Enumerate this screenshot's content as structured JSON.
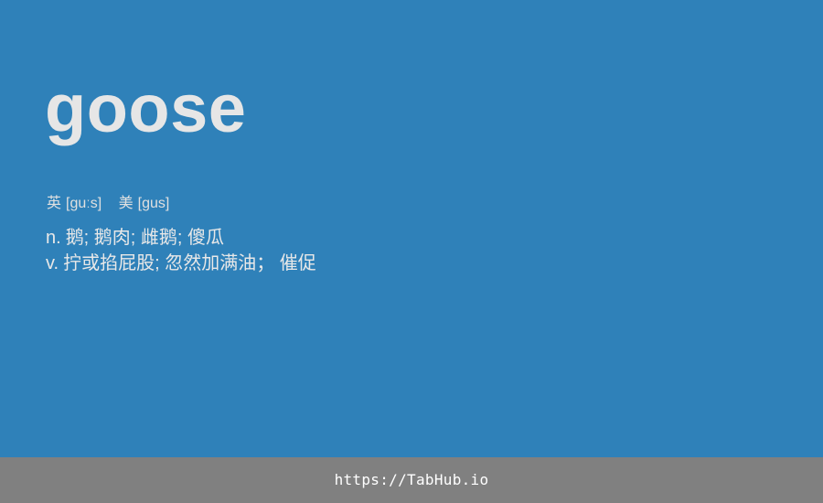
{
  "entry": {
    "word": "goose",
    "phonetics": [
      {
        "region": "英",
        "ipa": "[guːs]"
      },
      {
        "region": "美",
        "ipa": "[gus]"
      }
    ],
    "definitions": [
      {
        "pos": "n.",
        "meaning": "鹅; 鹅肉; 雌鹅; 傻瓜"
      },
      {
        "pos": "v.",
        "meaning": "拧或掐屁股; 忽然加满油； 催促"
      }
    ]
  },
  "footer": {
    "link_text": "https://TabHub.io"
  },
  "colors": {
    "background": "#2f81b9",
    "footer_background": "#808080",
    "text": "#e6e6e6"
  }
}
